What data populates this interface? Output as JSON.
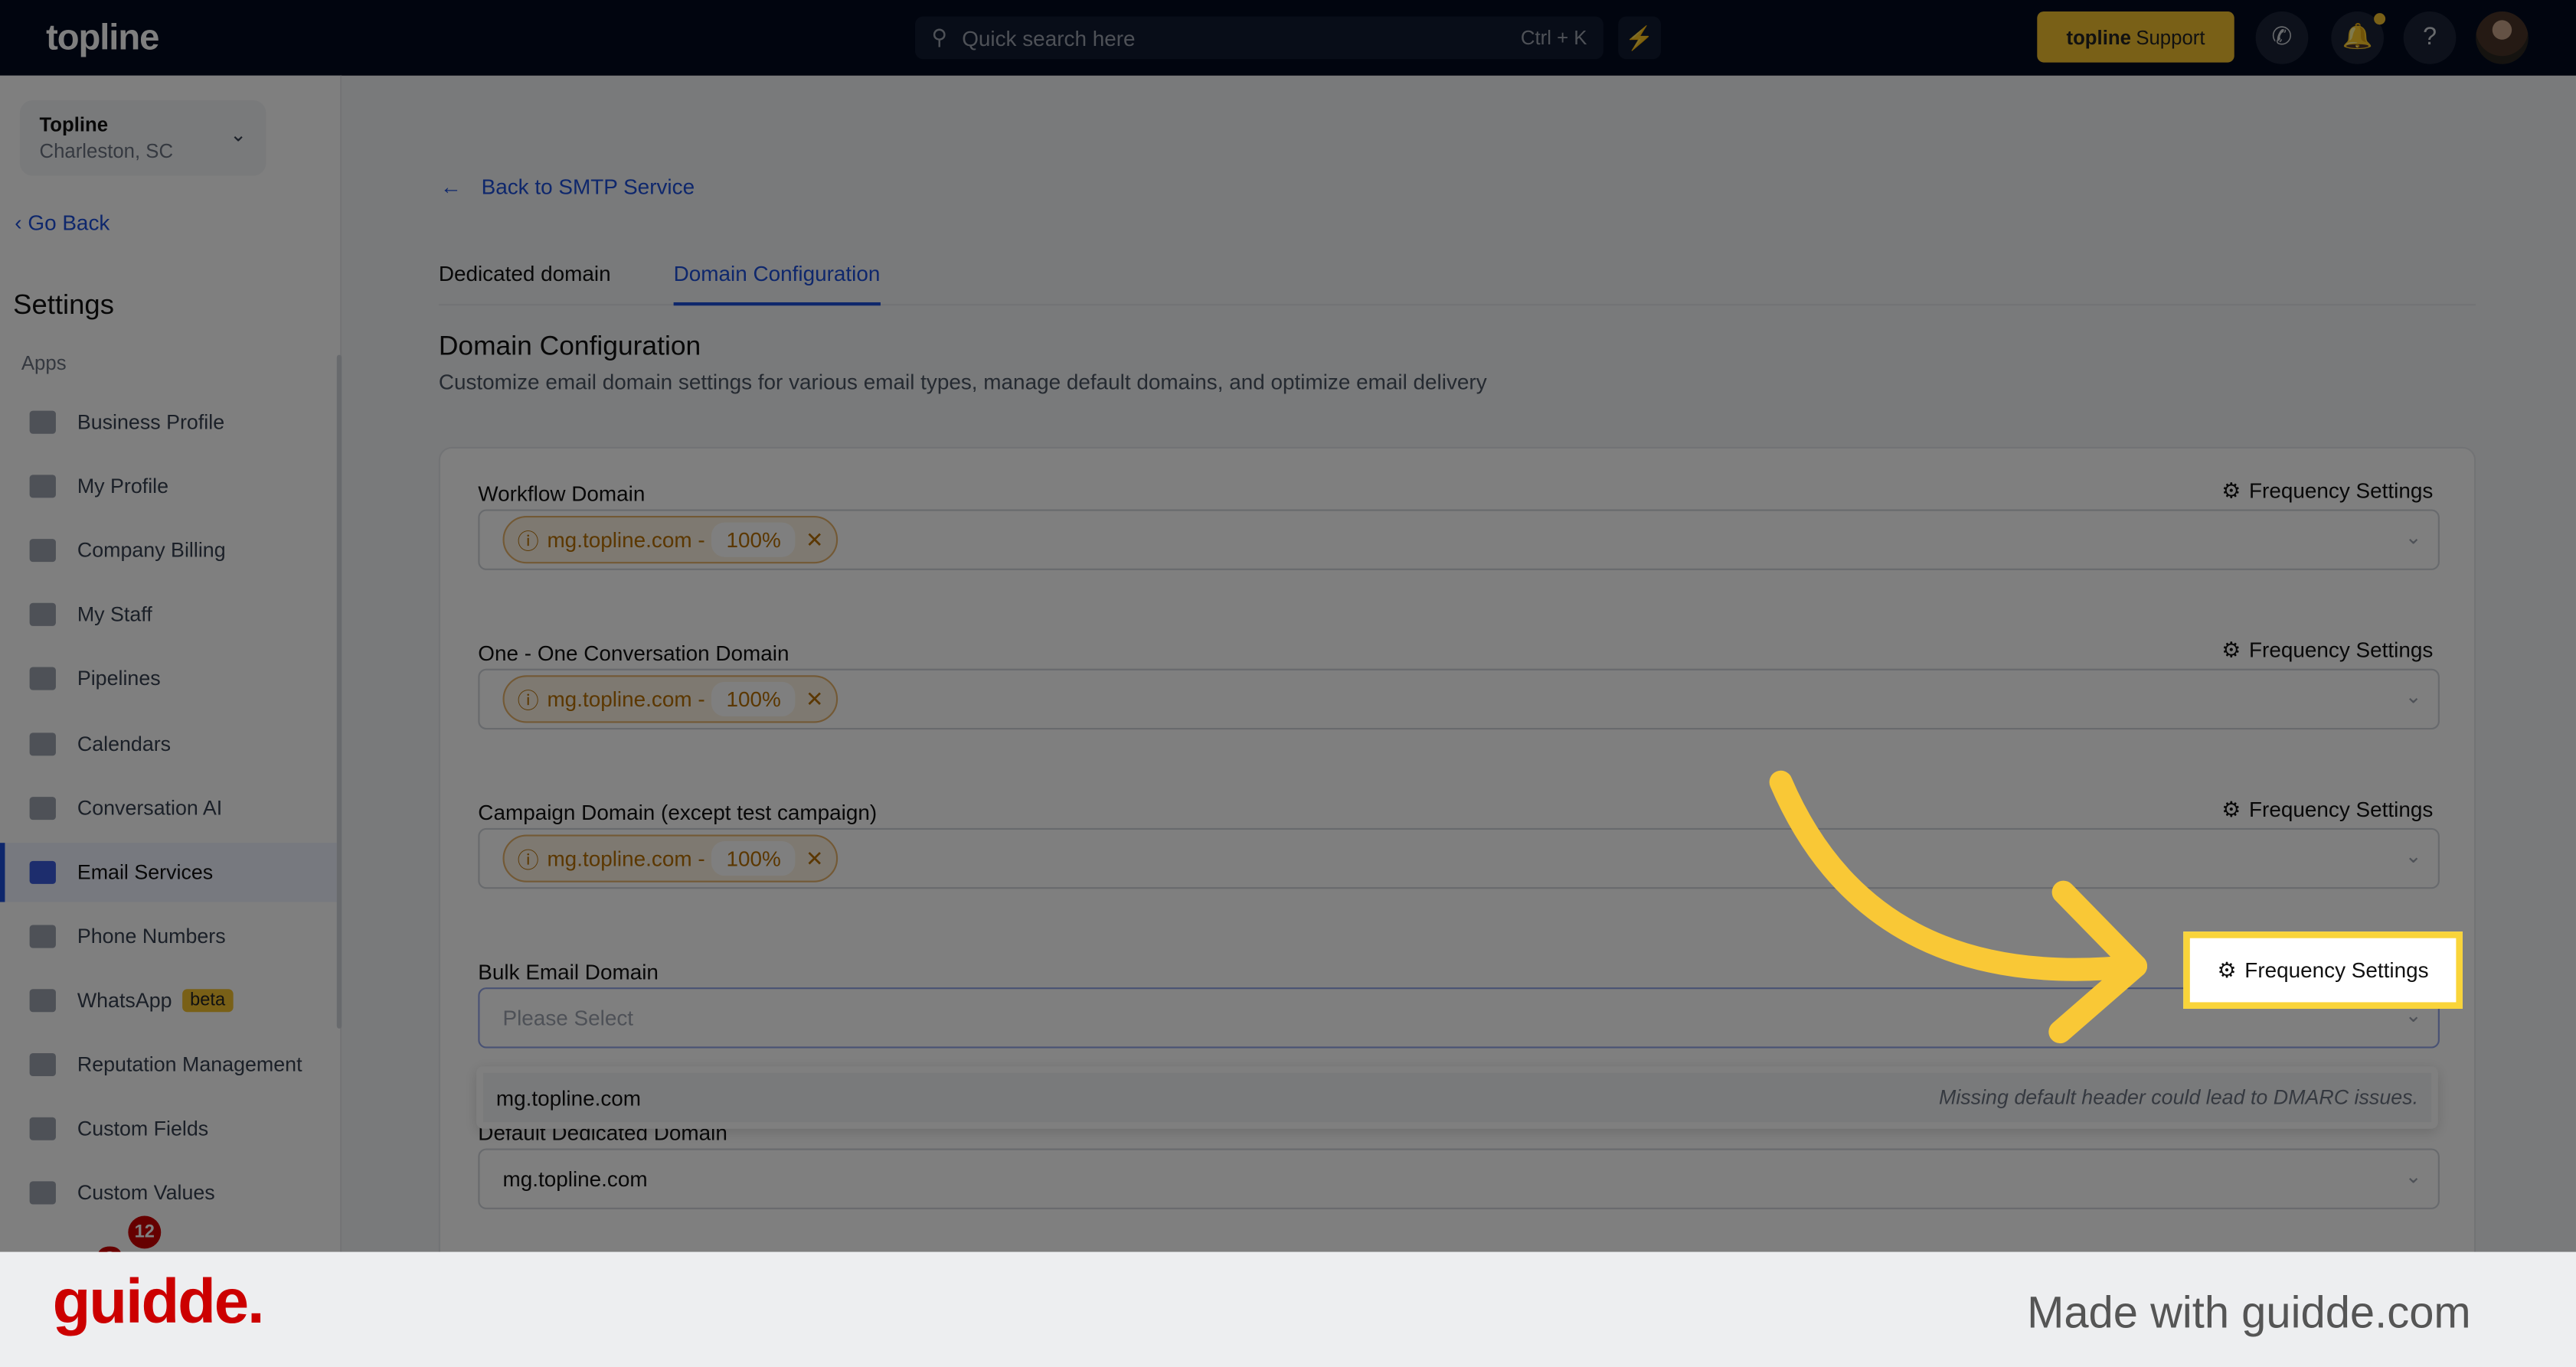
{
  "topbar": {
    "logo": "topline",
    "search_placeholder": "Quick search here",
    "search_shortcut": "Ctrl + K",
    "support_brand": "topline",
    "support_label": "Support",
    "icons": [
      "search-icon",
      "bolt-icon",
      "phone-icon",
      "bell-icon",
      "help-icon",
      "avatar"
    ]
  },
  "sidebar": {
    "location_name": "Topline",
    "location_city": "Charleston, SC",
    "go_back": "Go Back",
    "title": "Settings",
    "section": "Apps",
    "items": [
      {
        "label": "Business Profile"
      },
      {
        "label": "My Profile"
      },
      {
        "label": "Company Billing"
      },
      {
        "label": "My Staff"
      },
      {
        "label": "Pipelines"
      },
      {
        "label": "Calendars"
      },
      {
        "label": "Conversation AI"
      },
      {
        "label": "Email Services",
        "active": true
      },
      {
        "label": "Phone Numbers"
      },
      {
        "label": "WhatsApp",
        "badge": "beta"
      },
      {
        "label": "Reputation Management"
      },
      {
        "label": "Custom Fields"
      },
      {
        "label": "Custom Values"
      }
    ],
    "chat_badge": "12"
  },
  "main": {
    "back_link": "Back to SMTP Service",
    "tabs": [
      {
        "label": "Dedicated domain"
      },
      {
        "label": "Domain Configuration",
        "active": true
      }
    ],
    "heading": "Domain Configuration",
    "subheading": "Customize email domain settings for various email types, manage default domains, and optimize email delivery",
    "frequency_label": "Frequency Settings",
    "fields": [
      {
        "label": "Workflow Domain",
        "chip_domain": "mg.topline.com -",
        "chip_pct": "100%"
      },
      {
        "label": "One - One Conversation Domain",
        "chip_domain": "mg.topline.com -",
        "chip_pct": "100%"
      },
      {
        "label": "Campaign Domain (except test campaign)",
        "chip_domain": "mg.topline.com -",
        "chip_pct": "100%"
      },
      {
        "label": "Bulk Email Domain",
        "placeholder": "Please Select"
      },
      {
        "label": "Default Dedicated Domain",
        "value": "mg.topline.com"
      }
    ],
    "dropdown_option": "mg.topline.com",
    "dropdown_warning": "Missing default header could lead to DMARC issues."
  },
  "highlight": {
    "label": "Frequency Settings",
    "color": "#f9d43a"
  },
  "footer": {
    "logo": "guidde.",
    "made_with": "Made with guidde.com"
  }
}
